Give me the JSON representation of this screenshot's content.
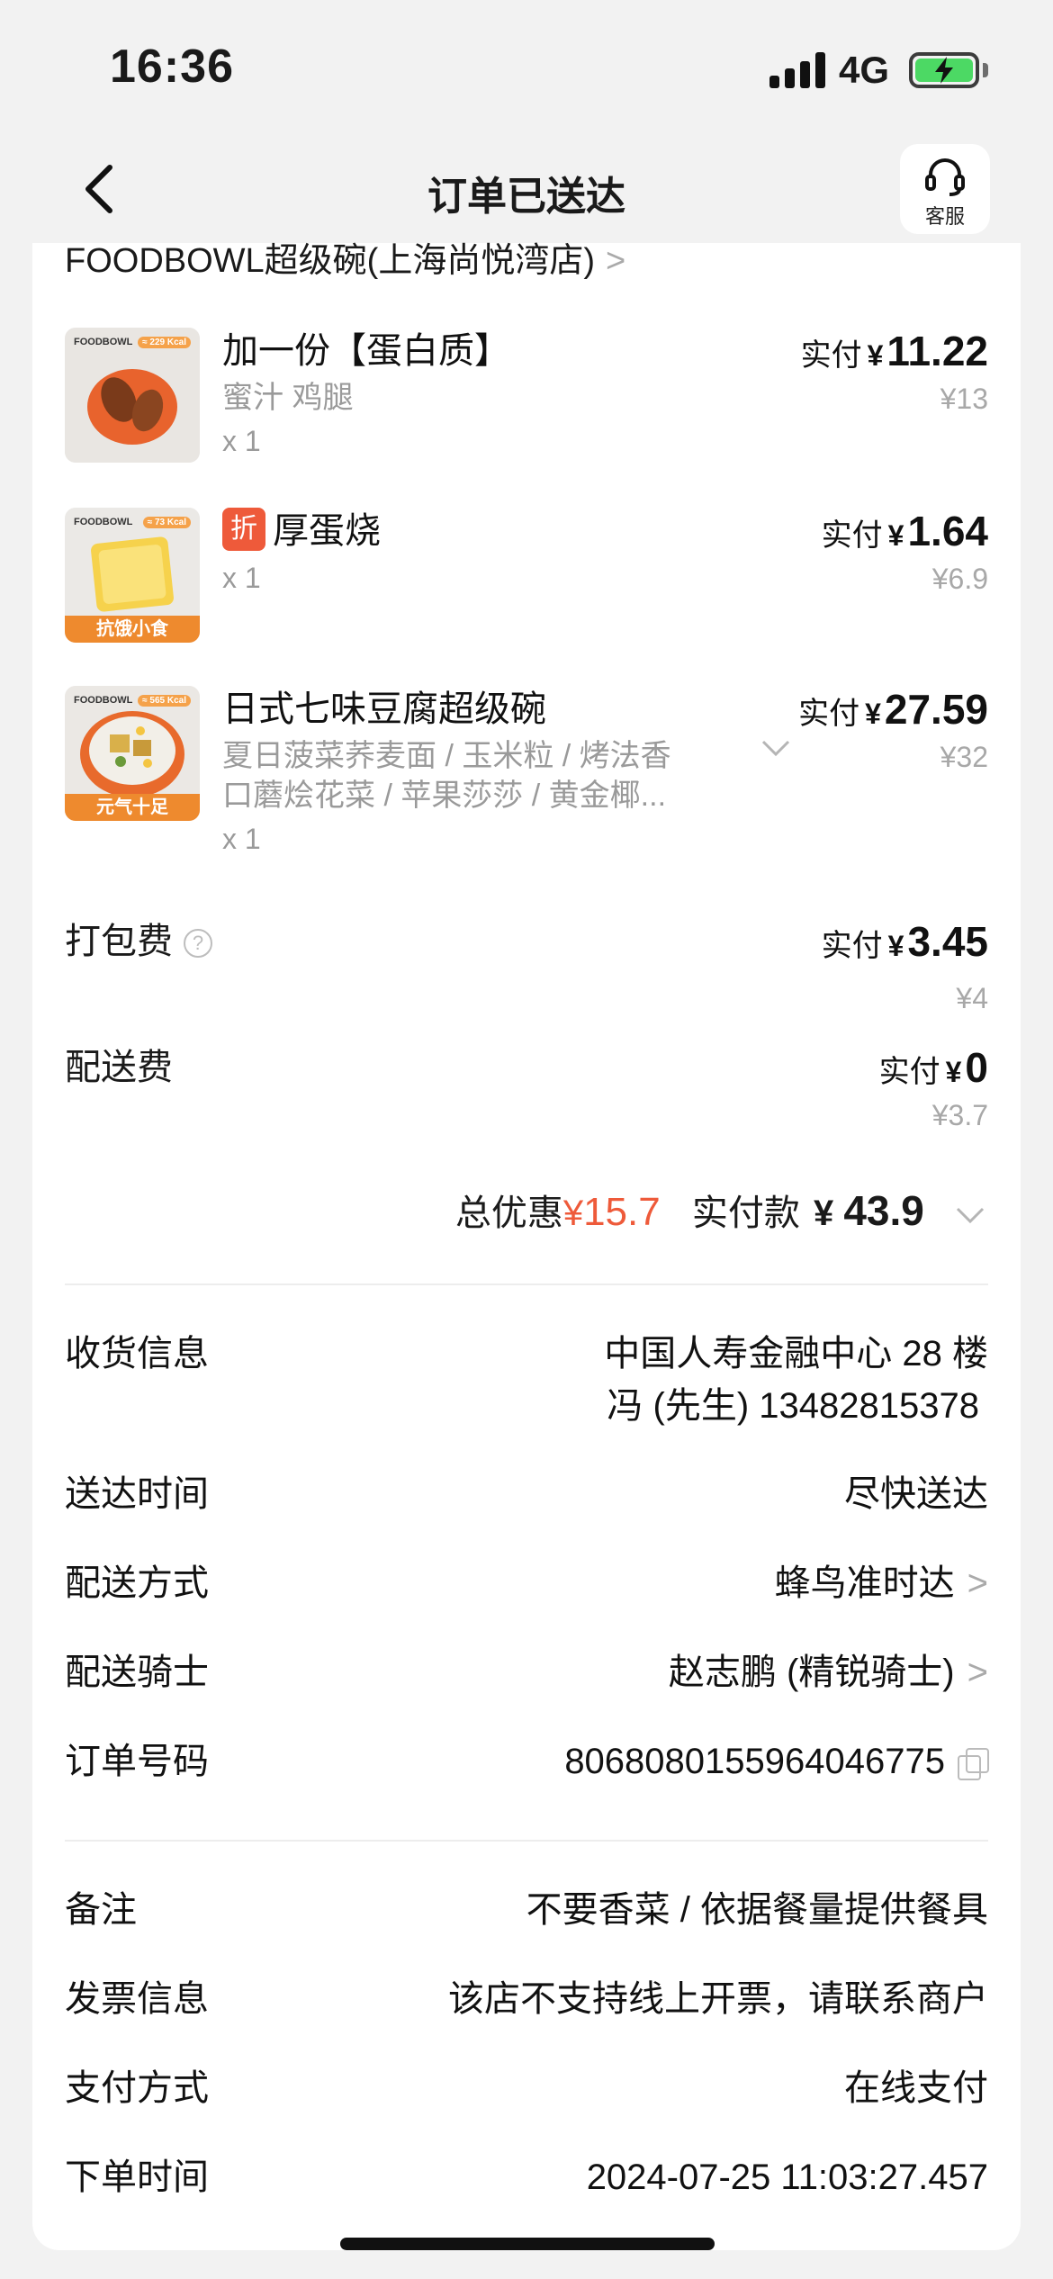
{
  "status_bar": {
    "time": "16:36",
    "network": "4G"
  },
  "nav": {
    "title": "订单已送达",
    "service_label": "客服"
  },
  "shop": {
    "name": "FOODBOWL超级碗(上海尚悦湾店)"
  },
  "items": [
    {
      "name": "加一份【蛋白质】",
      "sub": "蜜汁 鸡腿",
      "qty": "x 1",
      "paid_label": "实付",
      "currency": "¥",
      "paid": "11.22",
      "original": "¥13",
      "thumb_brand": "FOODBOWL",
      "thumb_kcal": "≈ 229 Kcal"
    },
    {
      "badge": "折",
      "name": "厚蛋烧",
      "qty": "x 1",
      "paid_label": "实付",
      "currency": "¥",
      "paid": "1.64",
      "original": "¥6.9",
      "thumb_brand": "FOODBOWL",
      "thumb_kcal": "≈ 73 Kcal",
      "thumb_tag": "抗饿小食"
    },
    {
      "name": "日式七味豆腐超级碗",
      "sub_line1": "夏日菠菜荞麦面 / 玉米粒 / 烤法香",
      "sub_line2": "口蘑烩花菜 / 苹果莎莎 / 黄金椰...",
      "qty": "x 1",
      "paid_label": "实付",
      "currency": "¥",
      "paid": "27.59",
      "original": "¥32",
      "thumb_brand": "FOODBOWL",
      "thumb_kcal": "≈ 565 Kcal",
      "thumb_tag": "元气十足"
    }
  ],
  "fees": [
    {
      "label": "打包费",
      "paid_label": "实付",
      "currency": "¥",
      "paid": "3.45",
      "original": "¥4"
    },
    {
      "label": "配送费",
      "paid_label": "实付",
      "currency": "¥",
      "paid": "0",
      "original": "¥3.7"
    }
  ],
  "summary": {
    "discount_label": "总优惠",
    "currency": "¥",
    "discount": "15.7",
    "paid_label": "实付款",
    "total": "43.9"
  },
  "info": {
    "address_label": "收货信息",
    "address_line1": "中国人寿金融中心 28 楼",
    "address_line2": "冯 (先生) 13482815378",
    "delivery_time_label": "送达时间",
    "delivery_time": "尽快送达",
    "delivery_method_label": "配送方式",
    "delivery_method": "蜂鸟准时达",
    "rider_label": "配送骑士",
    "rider": "赵志鹏 (精锐骑士)",
    "order_no_label": "订单号码",
    "order_no": "8068080155964046775",
    "remark_label": "备注",
    "remark": "不要香菜 / 依据餐量提供餐具",
    "invoice_label": "发票信息",
    "invoice": "该店不支持线上开票，请联系商户",
    "payment_label": "支付方式",
    "payment": "在线支付",
    "order_time_label": "下单时间",
    "order_time": "2024-07-25 11:03:27.457"
  },
  "colors": {
    "accent_red": "#ee5a3a",
    "battery_green": "#4cd964",
    "tag_orange": "#ee8a2e"
  },
  "icons": [
    "back-icon",
    "headset-icon",
    "chevron-right-icon",
    "chevron-down-icon",
    "help-icon",
    "copy-icon"
  ]
}
